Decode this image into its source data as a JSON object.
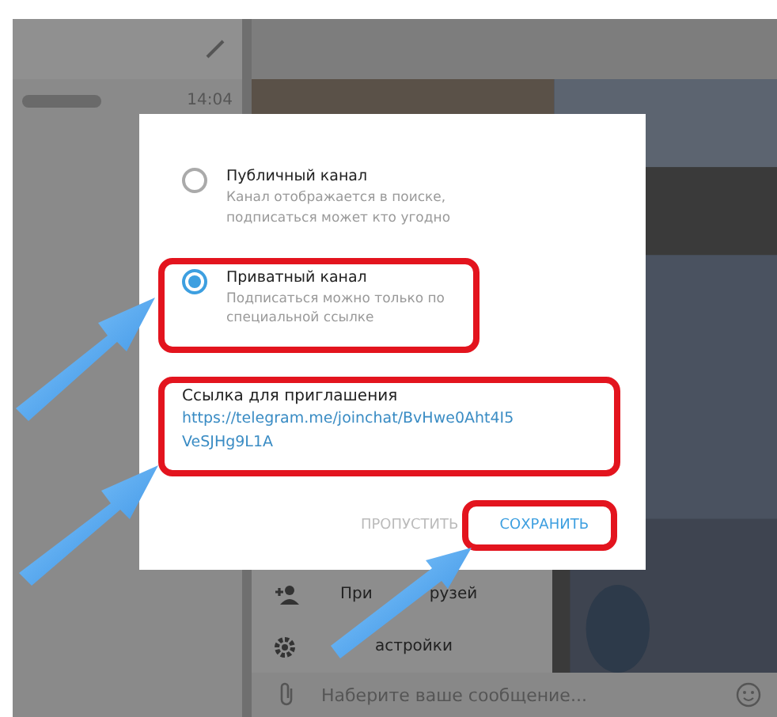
{
  "sidebar": {
    "times": [
      "14:04"
    ]
  },
  "chat": {
    "menu": [
      {
        "kind": "invite",
        "label_parts": [
          "При",
          "рузей"
        ]
      },
      {
        "kind": "settings",
        "label_parts": [
          "астройки"
        ]
      }
    ],
    "message_placeholder": "Наберите ваше сообщение..."
  },
  "dialog": {
    "options": [
      {
        "title": "Публичный канал",
        "description": "Канал отображается в поиске, подписаться может кто угодно",
        "selected": false
      },
      {
        "title": "Приватный канал",
        "description": "Подписаться можно только по специальной ссылке",
        "selected": true
      }
    ],
    "link_label": "Ссылка для приглашения",
    "link": "https://telegram.me/joinchat/BvHwe0Aht4I5VeSJHg9L1A",
    "buttons": [
      {
        "label": "ПРОПУСТИТЬ",
        "primary": false
      },
      {
        "label": "СОХРАНИТЬ",
        "primary": true
      }
    ]
  }
}
